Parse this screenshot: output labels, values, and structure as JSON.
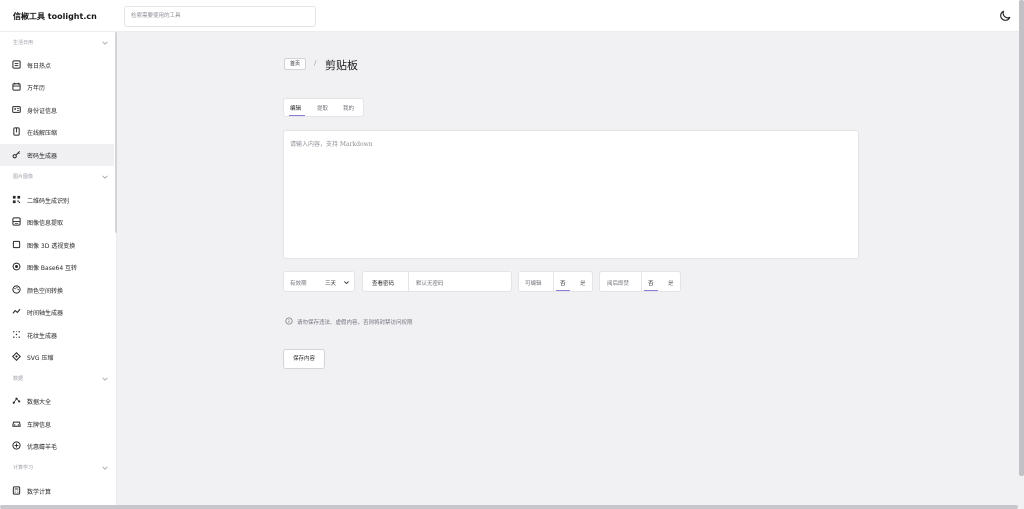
{
  "app": {
    "brand": "信椒工具 toolight.cn"
  },
  "search": {
    "placeholder": "检索需要使用的工具"
  },
  "icons": {
    "theme_toggle": "moon-icon",
    "info": "info-circle-icon"
  },
  "colors": {
    "accent": "#8b7fd9",
    "bg": "#f1f1f4"
  },
  "sidebar": {
    "groups": [
      {
        "label": "生活日用",
        "items": [
          {
            "label": "每日热点",
            "icon": "news-icon"
          },
          {
            "label": "万年历",
            "icon": "calendar-icon"
          },
          {
            "label": "身份证信息",
            "icon": "id-card-icon"
          },
          {
            "label": "在线解压缩",
            "icon": "archive-icon"
          },
          {
            "label": "密码生成器",
            "icon": "key-icon",
            "active": true
          }
        ]
      },
      {
        "label": "图片图像",
        "items": [
          {
            "label": "二维码生成识别",
            "icon": "qrcode-icon"
          },
          {
            "label": "图像信息提取",
            "icon": "image-info-icon"
          },
          {
            "label": "图像 3D 透视变换",
            "icon": "perspective-icon"
          },
          {
            "label": "图像 Base64 互转",
            "icon": "base64-icon"
          },
          {
            "label": "颜色空间转换",
            "icon": "palette-icon"
          },
          {
            "label": "时间轴生成器",
            "icon": "timeline-icon"
          },
          {
            "label": "花纹生成器",
            "icon": "pattern-icon"
          },
          {
            "label": "SVG 压缩",
            "icon": "svg-icon"
          }
        ]
      },
      {
        "label": "数据",
        "items": [
          {
            "label": "数据大全",
            "icon": "data-icon"
          },
          {
            "label": "车牌信息",
            "icon": "car-icon"
          },
          {
            "label": "优惠薅羊毛",
            "icon": "coupon-icon"
          }
        ]
      },
      {
        "label": "计算学习",
        "items": [
          {
            "label": "数学计算",
            "icon": "calculator-icon"
          }
        ]
      }
    ]
  },
  "breadcrumb": {
    "home": "首页",
    "separator": "/",
    "current": "剪贴板"
  },
  "tabs": [
    {
      "label": "编辑",
      "active": true
    },
    {
      "label": "提取"
    },
    {
      "label": "我的"
    }
  ],
  "editor": {
    "placeholder": "请输入内容，支持 Markdown"
  },
  "options": {
    "validity": {
      "label": "有效期",
      "value": "三天"
    },
    "password": {
      "label": "查看密码",
      "placeholder": "默认无密码"
    },
    "editable": {
      "label": "可编辑",
      "no": "否",
      "yes": "是",
      "selected": "否"
    },
    "burn": {
      "label": "阅后即焚",
      "no": "否",
      "yes": "是",
      "selected": "否"
    }
  },
  "notice": "请勿保存违法、虚假内容，否则将封禁访问权限",
  "save_button": "保存内容"
}
